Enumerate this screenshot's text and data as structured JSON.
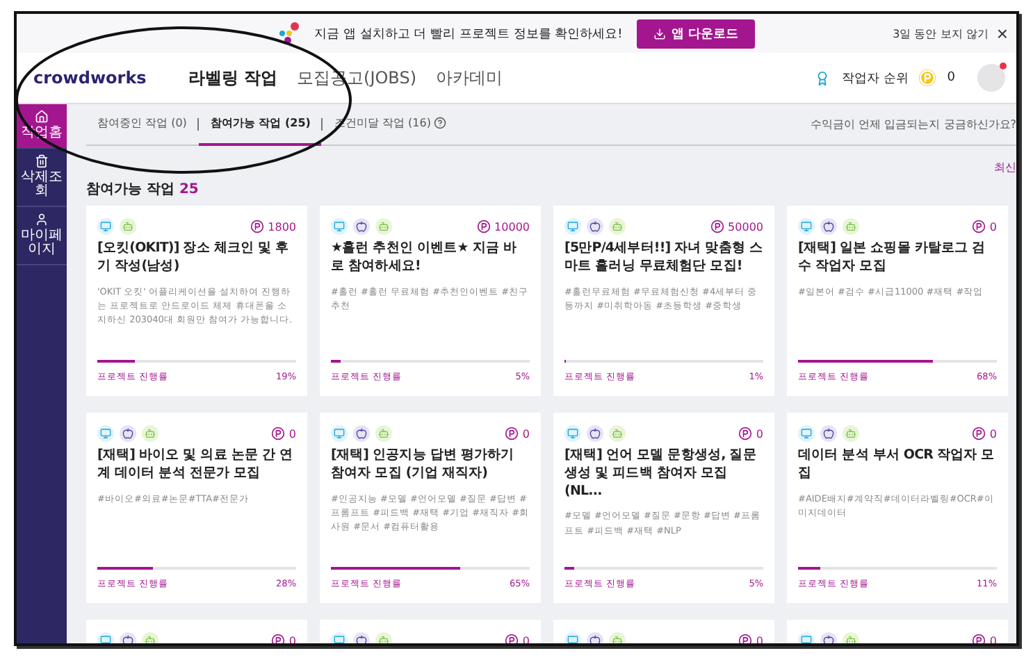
{
  "banner": {
    "message": "지금 앱 설치하고 더 빨리 프로젝트 정보를 확인하세요!",
    "button": "앱 다운로드",
    "dismiss": "3일 동안 보지 않기",
    "close": "×"
  },
  "header": {
    "logo": "crowdworks",
    "nav": [
      {
        "label": "라벨링 작업",
        "selected": true
      },
      {
        "label": "모집공고(JOBS)",
        "selected": false
      },
      {
        "label": "아카데미",
        "selected": false
      }
    ],
    "ranking": "작업자 순위",
    "points": "0"
  },
  "sidebar": {
    "items": [
      {
        "label": "작업홈",
        "kind": "home",
        "selected": true
      },
      {
        "label": "삭제조회",
        "kind": "trash",
        "selected": false
      },
      {
        "label": "마이페이지",
        "kind": "user",
        "selected": false
      }
    ]
  },
  "tabs": [
    {
      "label": "참여중인 작업 (0)",
      "selected": false,
      "help": false
    },
    {
      "label": "참여가능 작업 (25)",
      "selected": true,
      "help": false
    },
    {
      "label": "조건미달 작업 (16)",
      "selected": false,
      "help": true
    }
  ],
  "faq_link": "수익금이 언제 입금되는지 궁금하신가요?",
  "sort_label": "최신",
  "section": {
    "title": "참여가능 작업",
    "count": "25"
  },
  "cards": [
    {
      "platforms": [
        {
          "kind": "pc"
        },
        {
          "kind": "android"
        }
      ],
      "points": "1800",
      "title": "[오킷(OKIT)] 장소 체크인 및 후기 작성(남성)",
      "tags": "'OKIT 오킷' 어플리케이션을 설치하여 진행하는 프로젝트로 안드로이드 체제 휴대폰을 소지하신 203040대 회원만 참여가 가능합니다.",
      "progress_label": "프로젝트 진행률",
      "level": 0.19,
      "percent": "19%"
    },
    {
      "platforms": [
        {
          "kind": "pc"
        },
        {
          "kind": "ios"
        },
        {
          "kind": "android"
        }
      ],
      "points": "10000",
      "title": "★홀런 추천인 이벤트★ 지금 바로 참여하세요!",
      "tags": "#홀런 #홀런 무료체험 #추천인이벤트 #친구추천",
      "progress_label": "프로젝트 진행률",
      "level": 0.05,
      "percent": "5%"
    },
    {
      "platforms": [
        {
          "kind": "pc"
        },
        {
          "kind": "ios"
        },
        {
          "kind": "android"
        }
      ],
      "points": "50000",
      "title": "[5만P/4세부터!!] 자녀 맞춤형 스마트 홀러닝 무료체험단 모집!",
      "tags": "#홀런무료체험 #무료체험신청 #4세부터 중등까지 #미취학아동 #초등학생 #중학생",
      "progress_label": "프로젝트 진행률",
      "level": 0.01,
      "percent": "1%"
    },
    {
      "platforms": [
        {
          "kind": "pc"
        },
        {
          "kind": "ios"
        },
        {
          "kind": "android"
        }
      ],
      "points": "0",
      "title": "[재택] 일본 쇼핑몰 카탈로그 검수 작업자 모집",
      "tags": "#일본어 #검수 #시급11000 #재택 #작업",
      "progress_label": "프로젝트 진행률",
      "level": 0.68,
      "percent": "68%"
    },
    {
      "platforms": [
        {
          "kind": "pc"
        },
        {
          "kind": "ios"
        },
        {
          "kind": "android"
        }
      ],
      "points": "0",
      "title": "[재택] 바이오 및 의료 논문 간 연계 데이터 분석 전문가 모집",
      "tags": "#바이오#의료#논문#TTA#전문가",
      "progress_label": "프로젝트 진행률",
      "level": 0.28,
      "percent": "28%"
    },
    {
      "platforms": [
        {
          "kind": "pc"
        },
        {
          "kind": "ios"
        },
        {
          "kind": "android"
        }
      ],
      "points": "0",
      "title": "[재택] 인공지능 답변 평가하기 참여자 모집 (기업 재직자)",
      "tags": "#인공지능 #모델 #언어모델 #질문 #답변 #프롬프트 #피드백 #재택 #기업 #재직자 #회사원 #문서 #컴퓨터활용",
      "progress_label": "프로젝트 진행률",
      "level": 0.65,
      "percent": "65%"
    },
    {
      "platforms": [
        {
          "kind": "pc"
        },
        {
          "kind": "ios"
        },
        {
          "kind": "android"
        }
      ],
      "points": "0",
      "title": "[재택] 언어 모델 문항생성, 질문 생성 및 피드백 참여자 모집 (NL...",
      "tags": "#모델 #언어모델 #질문 #문항 #답변 #프롬프트 #피드백 #재택 #NLP",
      "progress_label": "프로젝트 진행률",
      "level": 0.05,
      "percent": "5%"
    },
    {
      "platforms": [
        {
          "kind": "pc"
        },
        {
          "kind": "ios"
        },
        {
          "kind": "android"
        }
      ],
      "points": "0",
      "title": "데이터 분석 부서 OCR 작업자 모집",
      "tags": "#AIDE배지#계약직#데이터라벨링#OCR#이미지데이터",
      "progress_label": "프로젝트 진행률",
      "level": 0.11,
      "percent": "11%"
    },
    {
      "platforms": [
        {
          "kind": "pc"
        },
        {
          "kind": "ios"
        },
        {
          "kind": "android"
        }
      ],
      "points": "0"
    },
    {
      "platforms": [
        {
          "kind": "pc"
        },
        {
          "kind": "ios"
        },
        {
          "kind": "android"
        }
      ],
      "points": "0"
    },
    {
      "platforms": [
        {
          "kind": "pc"
        },
        {
          "kind": "ios"
        },
        {
          "kind": "android"
        }
      ],
      "points": "0"
    },
    {
      "platforms": [
        {
          "kind": "pc"
        },
        {
          "kind": "ios"
        },
        {
          "kind": "android"
        }
      ],
      "points": "0"
    }
  ]
}
